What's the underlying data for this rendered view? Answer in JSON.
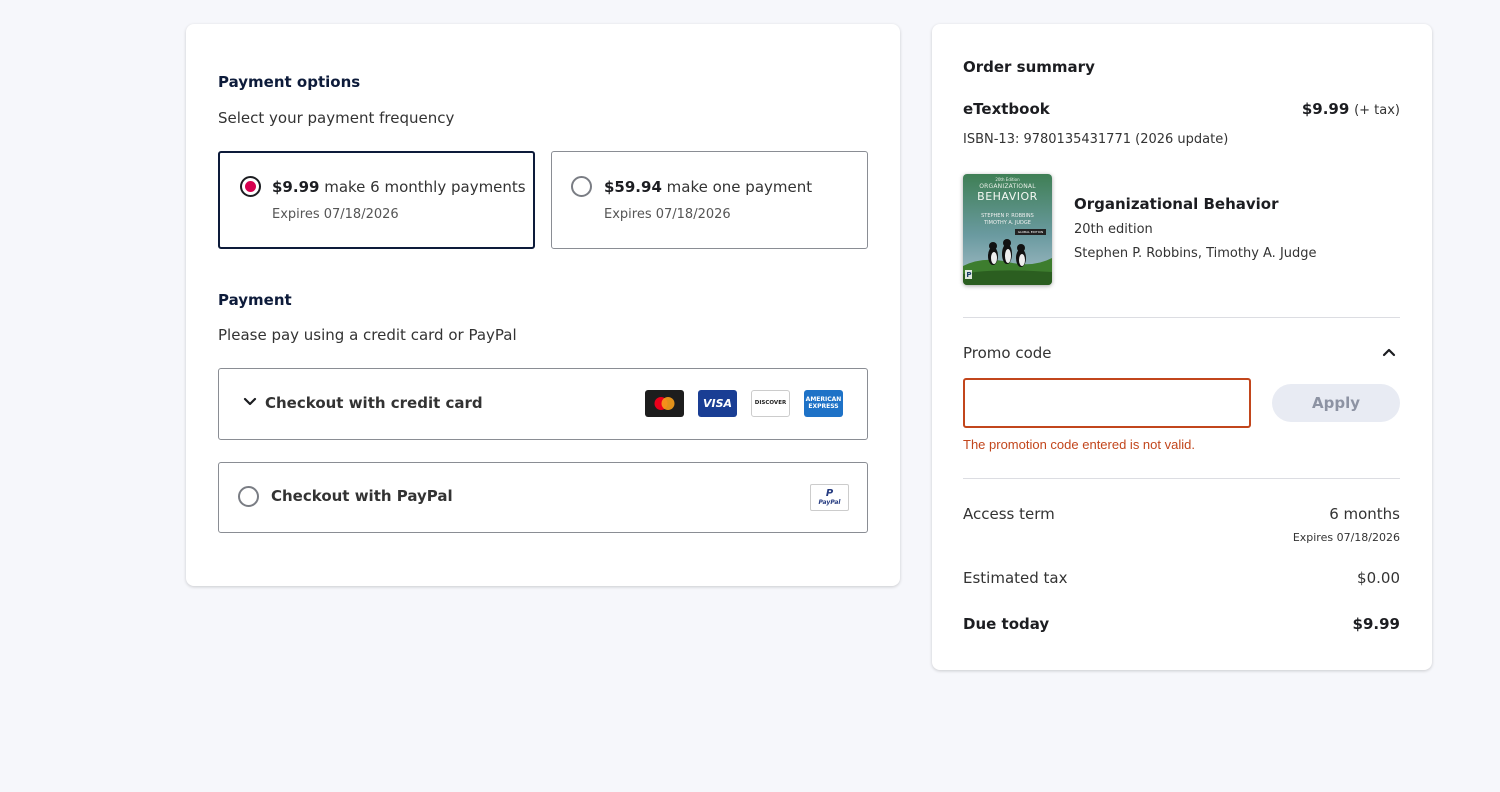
{
  "payment_options": {
    "title": "Payment options",
    "subtitle": "Select your payment frequency",
    "options": [
      {
        "price": "$9.99",
        "text": " make 6 monthly payments",
        "expires": "Expires 07/18/2026",
        "selected": true
      },
      {
        "price": "$59.94",
        "text": " make one payment",
        "expires": "Expires 07/18/2026",
        "selected": false
      }
    ]
  },
  "payment": {
    "title": "Payment",
    "subtitle": "Please pay using a credit card or PayPal",
    "credit_card_label": "Checkout with credit card",
    "paypal_label": "Checkout with PayPal",
    "card_icons": [
      "mastercard-icon",
      "visa-icon",
      "discover-icon",
      "amex-icon"
    ],
    "visa_text": "VISA",
    "discover_text": "DISCOVER",
    "amex_text": "AMERICAN EXPRESS",
    "paypal_logo_text": "PayPal"
  },
  "summary": {
    "title": "Order summary",
    "product_type": "eTextbook",
    "price": "$9.99",
    "price_note": "(+ tax)",
    "isbn": "ISBN-13: 9780135431771 (2026 update)",
    "book": {
      "title": "Organizational Behavior",
      "edition": "20th edition",
      "authors": "Stephen P. Robbins, Timothy A. Judge",
      "cover_line1": "ORGANIZATIONAL",
      "cover_line2": "BEHAVIOR",
      "cover_authors1": "STEPHEN P. ROBBINS",
      "cover_authors2": "TIMOTHY A. JUDGE",
      "cover_badge": "GLOBAL EDITION",
      "cover_top": "20th Edition",
      "cover_logo": "P"
    },
    "promo": {
      "label": "Promo code",
      "value": "",
      "placeholder": "",
      "apply_label": "Apply",
      "error": "The promotion code entered is not valid."
    },
    "access_term_label": "Access term",
    "access_term_value": "6 months",
    "access_term_expires": "Expires 07/18/2026",
    "tax_label": "Estimated tax",
    "tax_value": "$0.00",
    "due_label": "Due today",
    "due_value": "$9.99"
  },
  "colors": {
    "accent": "#d6004f",
    "error": "#c2461c",
    "navy": "#0d1b3a"
  }
}
